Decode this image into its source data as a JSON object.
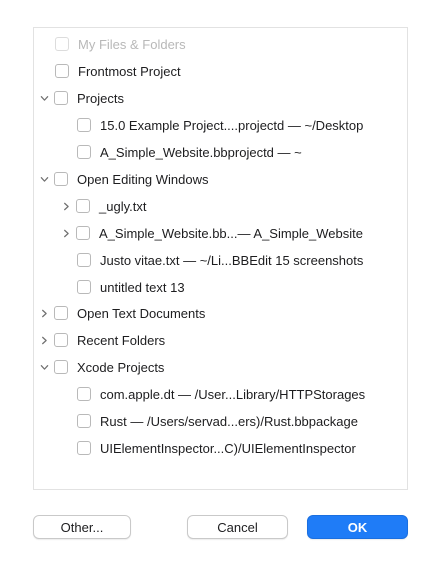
{
  "tree": {
    "items": [
      {
        "label": "My Files & Folders",
        "disabled": true
      },
      {
        "label": "Frontmost Project"
      },
      {
        "label": "Projects",
        "expanded": true
      },
      {
        "label": "15.0 Example Project....projectd — ~/Desktop"
      },
      {
        "label": "A_Simple_Website.bbprojectd — ~"
      },
      {
        "label": "Open Editing Windows",
        "expanded": true
      },
      {
        "label": "_ugly.txt",
        "expanded": false
      },
      {
        "label": "A_Simple_Website.bb...— A_Simple_Website",
        "expanded": false
      },
      {
        "label": "Justo vitae.txt — ~/Li...BBEdit 15 screenshots"
      },
      {
        "label": "untitled text 13"
      },
      {
        "label": "Open Text Documents",
        "expanded": false
      },
      {
        "label": "Recent Folders",
        "expanded": false
      },
      {
        "label": "Xcode Projects",
        "expanded": true
      },
      {
        "label": "com.apple.dt — /User...Library/HTTPStorages"
      },
      {
        "label": "Rust — /Users/servad...ers)/Rust.bbpackage"
      },
      {
        "label": "UIElementInspector...C)/UIElementInspector"
      }
    ]
  },
  "buttons": {
    "other": "Other...",
    "cancel": "Cancel",
    "ok": "OK"
  },
  "colors": {
    "accent": "#1f7cf7"
  }
}
